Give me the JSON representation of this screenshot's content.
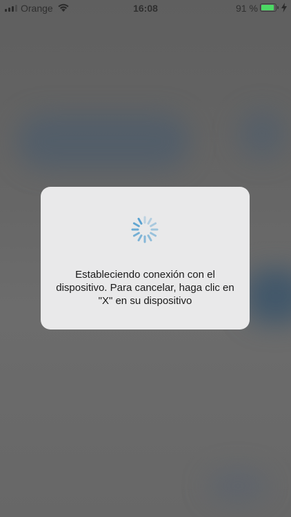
{
  "status_bar": {
    "carrier": "Orange",
    "time": "16:08",
    "battery_percent": "91 %",
    "battery_level": 0.91,
    "signal_bars_active": 3,
    "battery_color": "#4cd964"
  },
  "dialog": {
    "message": "Estableciendo conexión con el dispositivo. Para cancelar, haga clic en \"X\" en su dispositivo",
    "spinner_color": "#5aa2d0"
  },
  "icons": {
    "signal": "cellular-signal-icon",
    "wifi": "wifi-icon",
    "battery": "battery-icon",
    "charging": "charging-bolt-icon",
    "spinner": "loading-spinner-icon"
  }
}
